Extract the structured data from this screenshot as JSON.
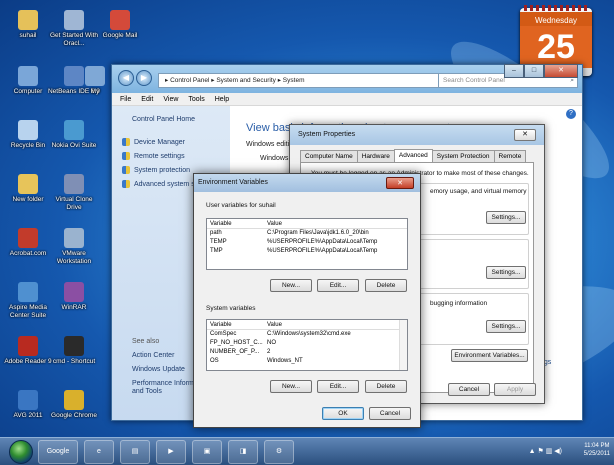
{
  "desktop_icons": [
    {
      "label": "suhail",
      "color": "#e5c15a"
    },
    {
      "label": "Get Started With Oracl...",
      "color": "#9fb6d4"
    },
    {
      "label": "Google Mail",
      "color": "#d44a3a"
    },
    {
      "label": "Computer",
      "color": "#7aa6d8"
    },
    {
      "label": "NetBeans IDE 6.9",
      "color": "#5d86c5"
    },
    {
      "label": "My",
      "color": "#7fa8d6"
    },
    {
      "label": "Recycle Bin",
      "color": "#b8d3ee"
    },
    {
      "label": "Nokia Ovi Suite",
      "color": "#4a9ad0"
    },
    {
      "label": "New folder",
      "color": "#e7c45a"
    },
    {
      "label": "Virtual Clone Drive",
      "color": "#7f8fb5"
    },
    {
      "label": "Acrobat.com",
      "color": "#c23b2b"
    },
    {
      "label": "VMware Workstation",
      "color": "#9ab3cf"
    },
    {
      "label": "Adobe Reader 9",
      "color": "#b82a20"
    },
    {
      "label": "Google Chrome",
      "color": "#d9b02c"
    },
    {
      "label": "AVG 2011",
      "color": "#3a76c2"
    },
    {
      "label": "WinRAR",
      "color": "#8b4fa3"
    },
    {
      "label": "Aspire Media Center Suite",
      "color": "#4f90d0"
    },
    {
      "label": "cmd - Shortcut",
      "color": "#2a2a2a"
    }
  ],
  "gadget": {
    "day": "Wednesday",
    "date": "25"
  },
  "control_panel": {
    "breadcrumb": "▸  Control Panel  ▸  System and Security  ▸  System",
    "search_placeholder": "Search Control Panel",
    "menu": [
      "File",
      "Edit",
      "View",
      "Tools",
      "Help"
    ],
    "home": "Control Panel Home",
    "side_links": [
      "Device Manager",
      "Remote settings",
      "System protection",
      "Advanced system settings"
    ],
    "see_also": "See also",
    "see_links": [
      "Action Center",
      "Windows Update",
      "Performance Information and Tools"
    ],
    "main_heading": "View basic information about your computer",
    "main_edition": "Windows edition",
    "main_win7": "Windows 7",
    "right_link": "ngs"
  },
  "system_properties": {
    "title": "System Properties",
    "tabs": [
      "Computer Name",
      "Hardware",
      "Advanced",
      "System Protection",
      "Remote"
    ],
    "active_tab": "Advanced",
    "note": "You must be logged on as an Administrator to make most of these changes.",
    "perf_text": "emory usage, and virtual memory",
    "debug_text": "bugging information",
    "settings": "Settings...",
    "env_btn": "Environment Variables...",
    "cancel": "Cancel",
    "apply": "Apply"
  },
  "env_vars": {
    "title": "Environment Variables",
    "user_label": "User variables for suhail",
    "col_var": "Variable",
    "col_val": "Value",
    "user_rows": [
      {
        "var": "path",
        "val": "C:\\Program Files\\Java\\jdk1.6.0_20\\bin"
      },
      {
        "var": "TEMP",
        "val": "%USERPROFILE%\\AppData\\Local\\Temp"
      },
      {
        "var": "TMP",
        "val": "%USERPROFILE%\\AppData\\Local\\Temp"
      }
    ],
    "sys_label": "System variables",
    "sys_rows": [
      {
        "var": "ComSpec",
        "val": "C:\\Windows\\system32\\cmd.exe"
      },
      {
        "var": "FP_NO_HOST_C...",
        "val": "NO"
      },
      {
        "var": "NUMBER_OF_P...",
        "val": "2"
      },
      {
        "var": "OS",
        "val": "Windows_NT"
      }
    ],
    "new": "New...",
    "edit": "Edit...",
    "delete": "Delete",
    "ok": "OK",
    "cancel": "Cancel"
  },
  "taskbar": {
    "google": "Google",
    "time": "11:04 PM",
    "date": "5/25/2011"
  }
}
